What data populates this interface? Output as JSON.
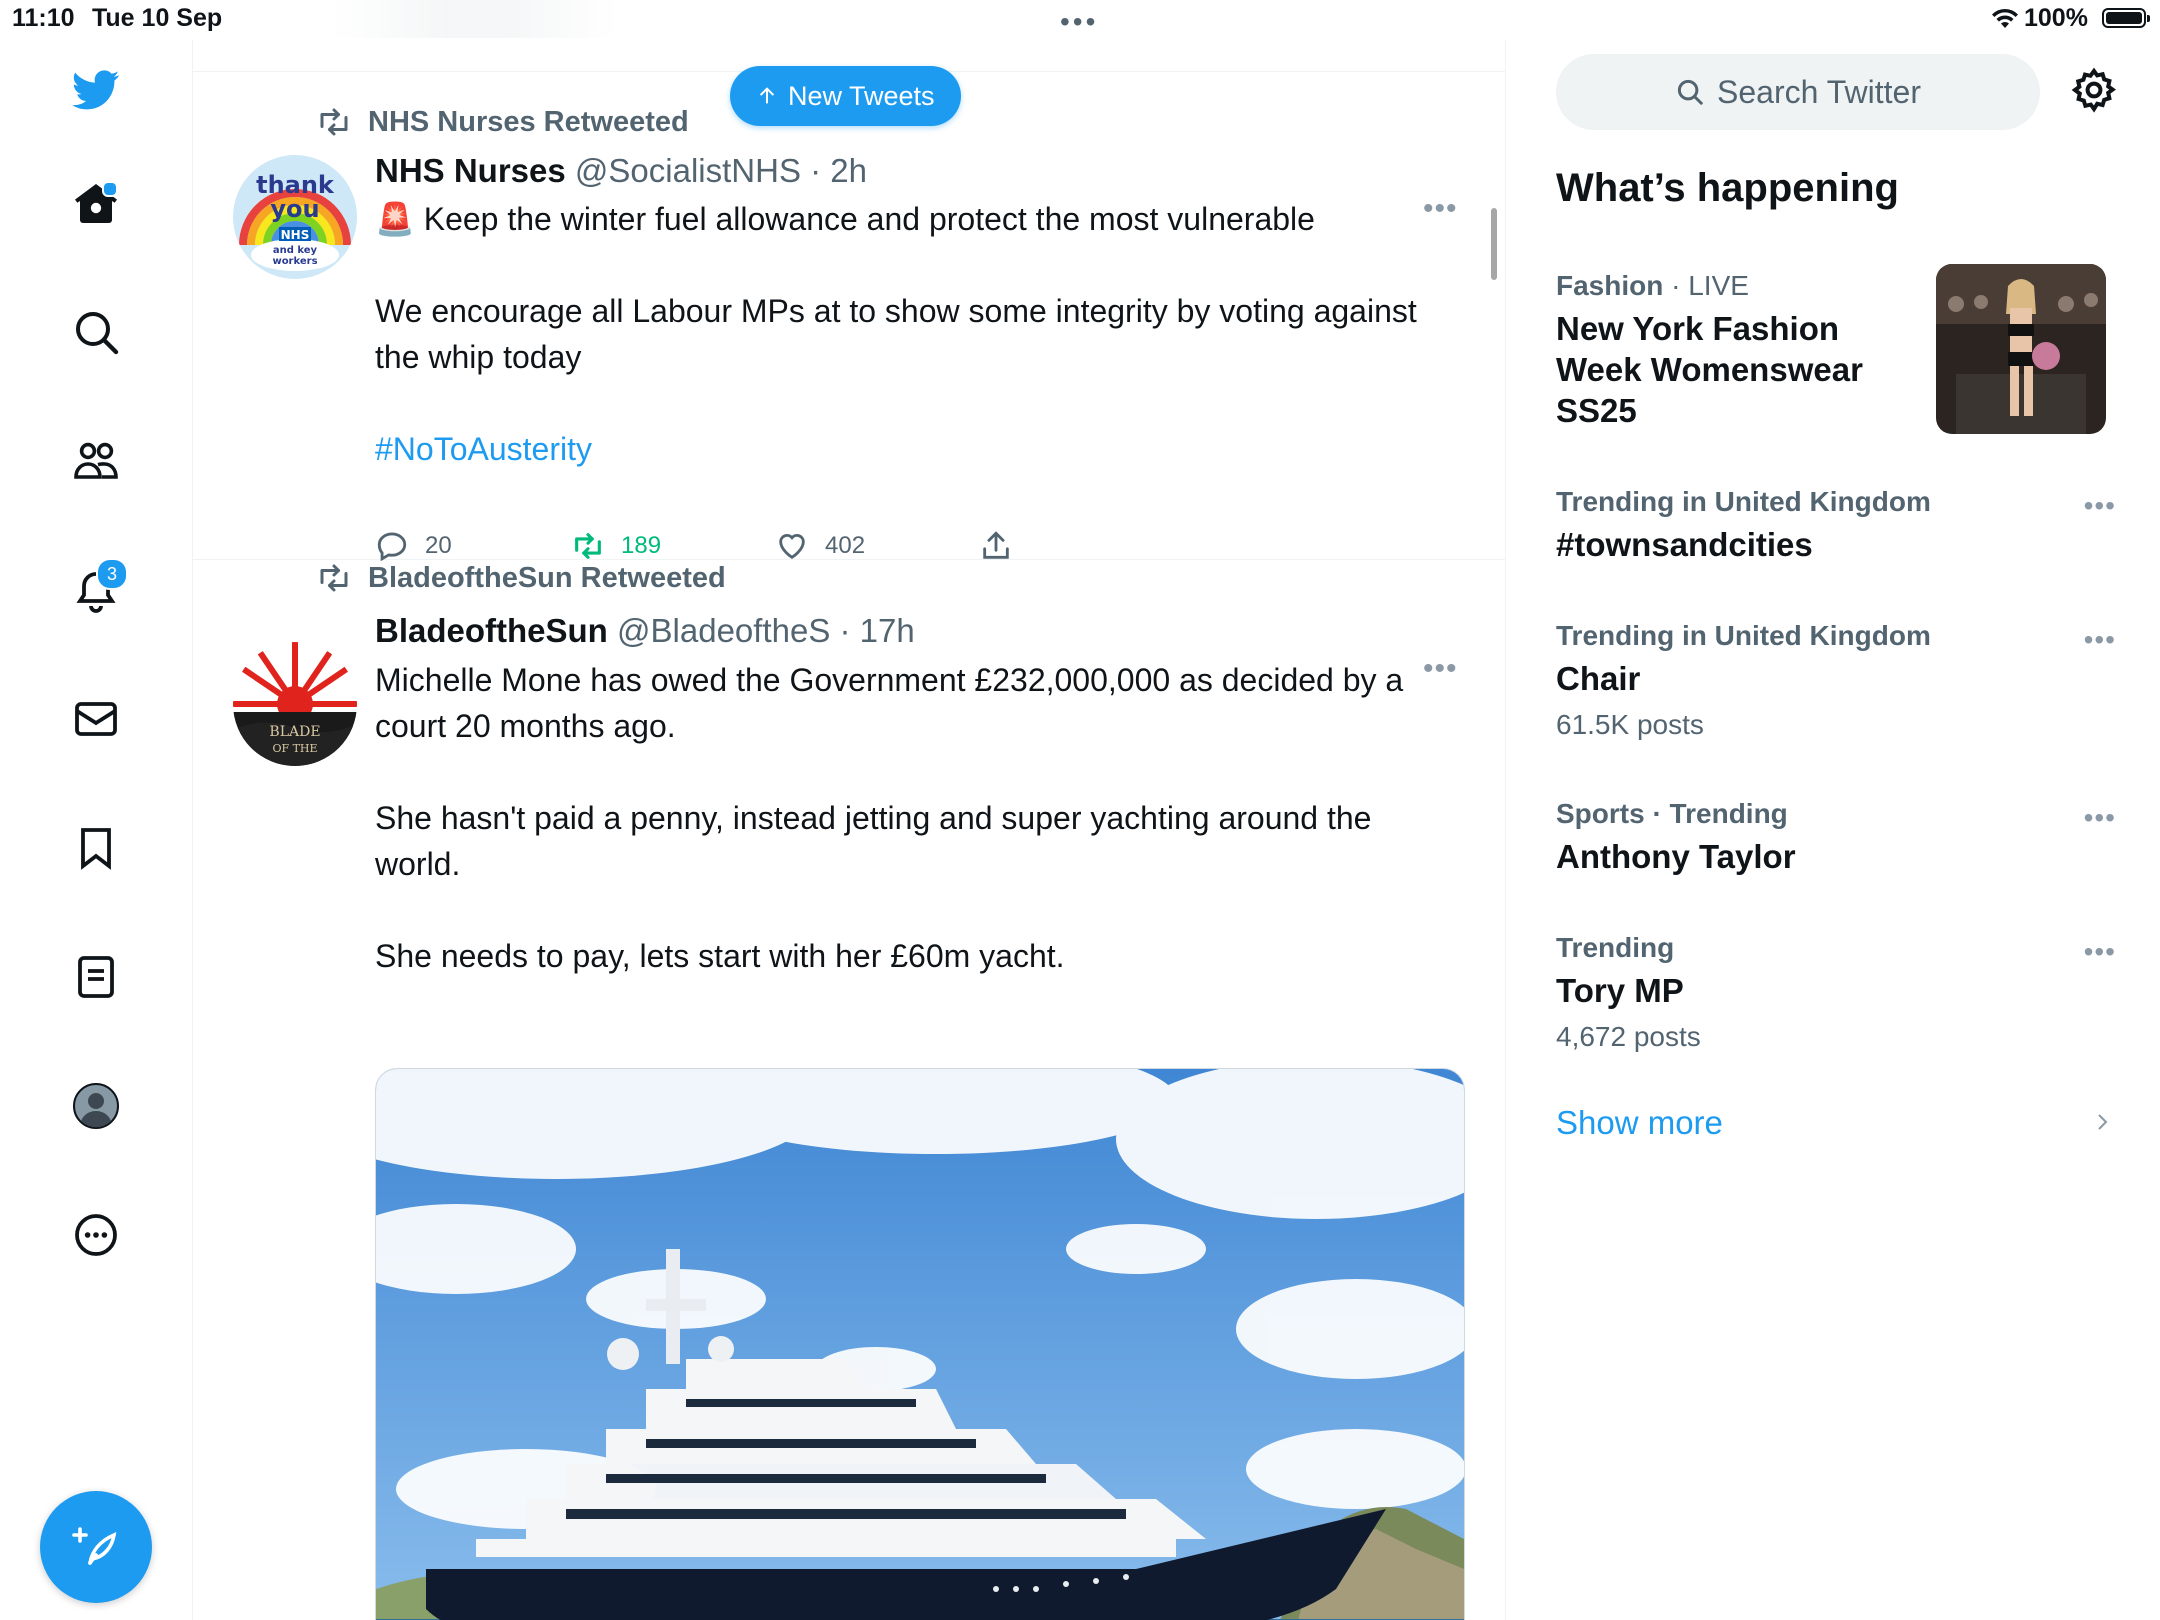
{
  "status_bar": {
    "time": "11:10",
    "date": "Tue 10 Sep",
    "battery": "100%",
    "dots": "•••"
  },
  "nav": {
    "notifications_badge": "3",
    "items": [
      "twitter-logo",
      "home",
      "explore",
      "communities",
      "notifications",
      "messages",
      "bookmarks",
      "lists",
      "profile",
      "more"
    ]
  },
  "new_tweets_label": "New Tweets",
  "tweets": [
    {
      "retweeted_by": "NHS Nurses Retweeted",
      "name": "NHS Nurses",
      "handle_time": "@SocialistNHS · 2h",
      "avatar_text": [
        "thank",
        "you",
        "NHS",
        "and key",
        "workers"
      ],
      "emoji": "🚨",
      "line1": " Keep the winter fuel allowance and protect the most vulnerable",
      "line2": "We encourage all Labour MPs at to show some integrity by voting against the whip today",
      "hashtag": "#NoToAusterity",
      "replies": "20",
      "retweets": "189",
      "likes": "402"
    },
    {
      "retweeted_by": "BladeoftheSun Retweeted",
      "name": "BladeoftheSun",
      "handle_time": "@BladeoftheS · 17h",
      "avatar_text": [
        "BLADE",
        "OF THE"
      ],
      "line1": "Michelle Mone has owed the Government £232,000,000 as decided by a court 20 months ago.",
      "line2": "She hasn't paid a penny, instead jetting and super yachting around the world.",
      "line3": "She needs to pay, lets start with her £60m yacht."
    }
  ],
  "right": {
    "search_placeholder": "Search Twitter",
    "section_title": "What’s happening",
    "trends": [
      {
        "category": "Fashion",
        "sep": " · ",
        "live": "LIVE",
        "name": "New York Fashion Week Womenswear SS25",
        "count": ""
      },
      {
        "category": "Trending in United Kingdom",
        "name": "#townsandcities",
        "count": ""
      },
      {
        "category": "Trending in United Kingdom",
        "name": "Chair",
        "count": "61.5K posts"
      },
      {
        "category": "Sports · Trending",
        "name": "Anthony Taylor",
        "count": ""
      },
      {
        "category": "Trending",
        "name": "Tory MP",
        "count": "4,672 posts"
      }
    ],
    "more_dots": "•••",
    "show_more": "Show more"
  },
  "colors": {
    "accent": "#1d9bf0",
    "retweet_green": "#00ba7c",
    "muted": "#536471"
  }
}
